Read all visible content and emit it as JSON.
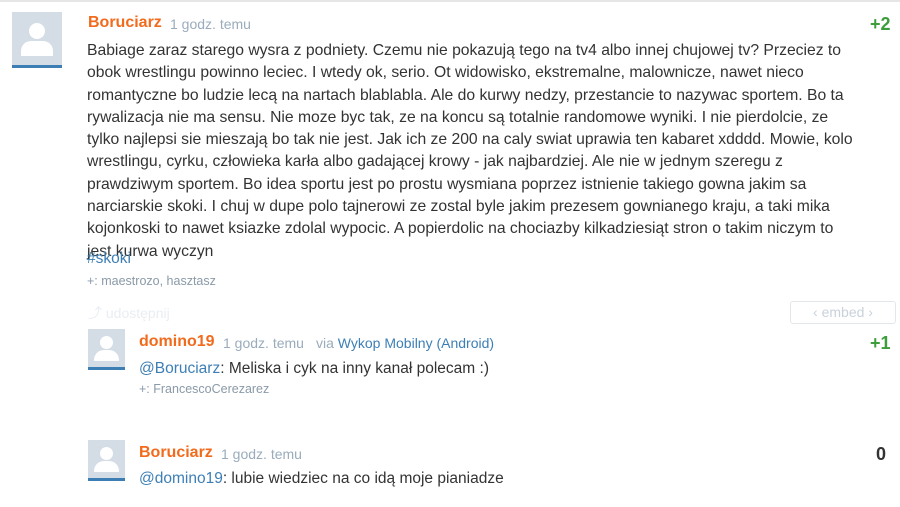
{
  "colors": {
    "author": "#f26b1d",
    "link": "#3d7fb5",
    "score_positive": "#3b9e3b",
    "meta": "#9aacbc"
  },
  "main_post": {
    "author": "Boruciarz",
    "time": "1 godz. temu",
    "score": "+2",
    "lines": [
      "Babiage zaraz starego wysra z podniety. Czemu nie pokazują tego na tv4 albo innej chujowej tv? Przeciez to",
      "obok wrestlingu powinno leciec. I wtedy ok, serio. Ot widowisko, ekstremalne, malownicze, nawet nieco",
      "romantyczne bo ludzie lecą na nartach blablabla. Ale do kurwy nedzy, przestancie to nazywac sportem. Bo ta",
      "rywalizacja nie ma sensu. Nie moze byc tak, ze na koncu są totalnie randomowe wyniki. I nie pierdolcie, ze",
      "tylko najlepsi sie mieszają bo tak nie jest. Jak ich ze 200 na caly swiat uprawia ten kabaret xdddd. Mowie, kolo",
      "wrestlingu, cyrku, człowieka karła albo gadającej krowy - jak najbardziej. Ale nie w jednym szeregu z",
      "prawdziwym sportem. Bo idea sportu jest po prostu wysmiana poprzez istnienie takiego gowna jakim sa",
      "narciarskie skoki. I chuj w dupe polo tajnerowi ze zostal byle jakim prezesem gownianego kraju, a taki mika",
      "kojonkoski to nawet ksiazke zdolal wypocic. A popierdolic na chociazby kilkadziesiąt stron o takim niczym to",
      "jest kurwa wyczyn"
    ],
    "tag": "#skoki",
    "voters": "+: maestrozo, hasztasz",
    "share_label": "udostępnij",
    "embed_label": "‹ embed ›"
  },
  "replies": [
    {
      "author": "domino19",
      "time": "1 godz. temu",
      "via_prefix": "via",
      "via_app": "Wykop Mobilny (Android)",
      "score": "+1",
      "mention": "@Boruciarz",
      "text": ": Meliska i cyk na inny kanał polecam :)",
      "voters": "+: FrancescoCerezarez"
    },
    {
      "author": "Boruciarz",
      "time": "1 godz. temu",
      "score": "0",
      "mention": "@domino19",
      "text": ": lubie wiedziec na co idą moje pianiadze"
    }
  ]
}
